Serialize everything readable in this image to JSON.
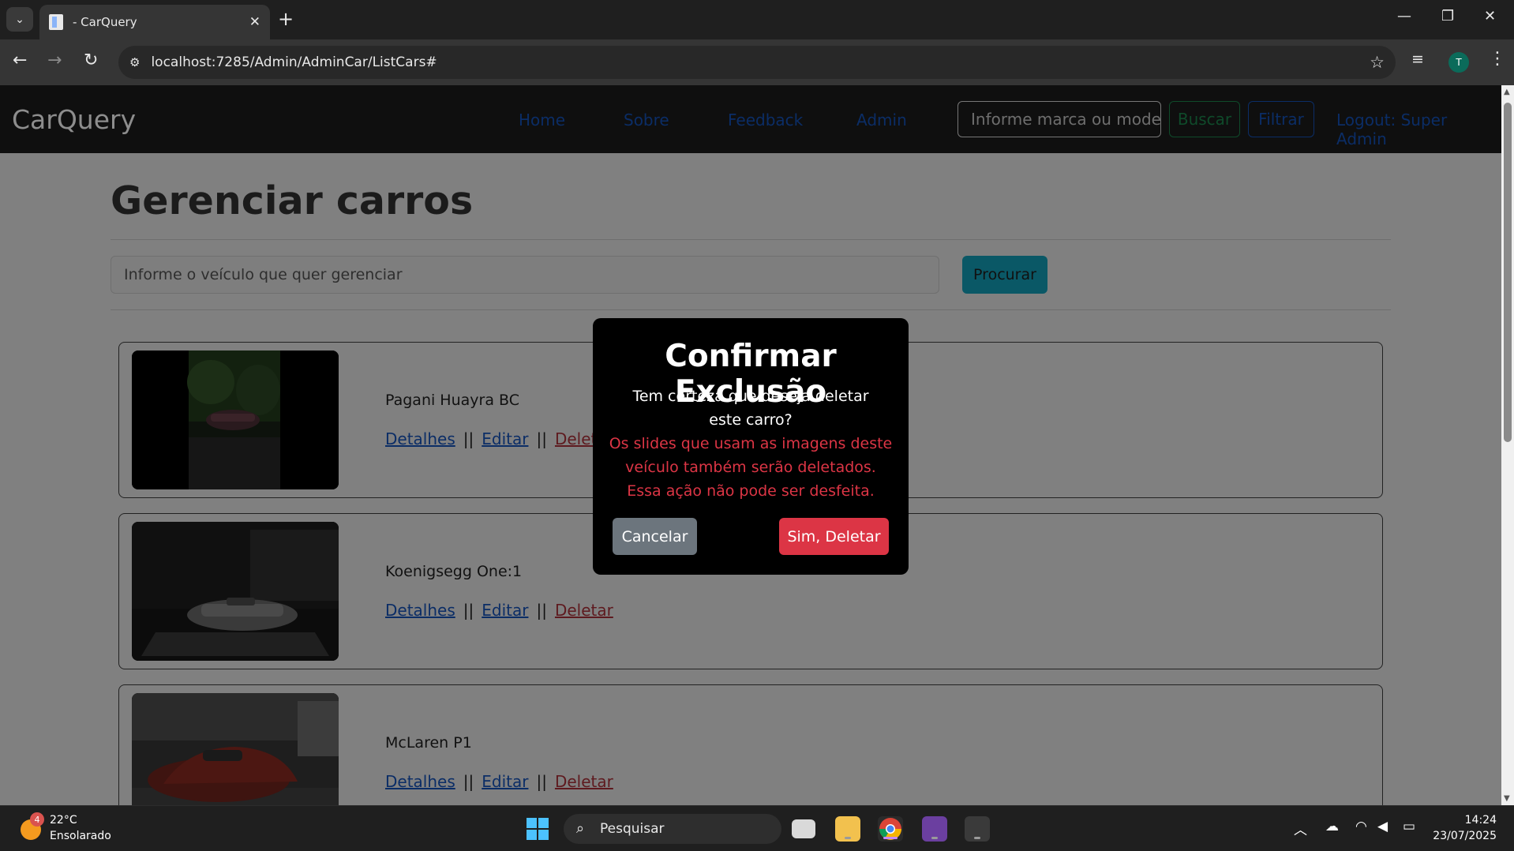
{
  "browser": {
    "tab_title": "- CarQuery",
    "url": "localhost:7285/Admin/AdminCar/ListCars#",
    "profile_initial": "T"
  },
  "site": {
    "brand": "CarQuery",
    "nav": {
      "home": "Home",
      "about": "Sobre",
      "feedback": "Feedback",
      "admin": "Admin"
    },
    "search_placeholder": "Informe marca ou modelo",
    "buscar": "Buscar",
    "filtrar": "Filtrar",
    "logout": "Logout: Super Admin"
  },
  "main": {
    "title": "Gerenciar carros",
    "search_placeholder": "Informe o veículo que quer gerenciar",
    "search_button": "Procurar",
    "separator": "||",
    "actions": {
      "details": "Detalhes",
      "edit": "Editar",
      "delete": "Deletar"
    },
    "cars": [
      {
        "name": "Pagani Huayra BC"
      },
      {
        "name": "Koenigsegg One:1"
      },
      {
        "name": "McLaren P1"
      }
    ]
  },
  "modal": {
    "title": "Confirmar Exclusão",
    "question": "Tem certeza que deseja deletar este carro?",
    "warning": "Os slides que usam as imagens deste veículo também serão deletados. Essa ação não pode ser desfeita.",
    "cancel": "Cancelar",
    "confirm": "Sim, Deletar"
  },
  "taskbar": {
    "weather_badge": "4",
    "temperature": "22°C",
    "condition": "Ensolarado",
    "search_label": "Pesquisar",
    "time": "14:24",
    "date": "23/07/2025"
  },
  "colors": {
    "danger": "#dc3545",
    "secondary": "#6c757d",
    "primary_link": "#0d6efd",
    "info_button": "#0dcaf0"
  }
}
